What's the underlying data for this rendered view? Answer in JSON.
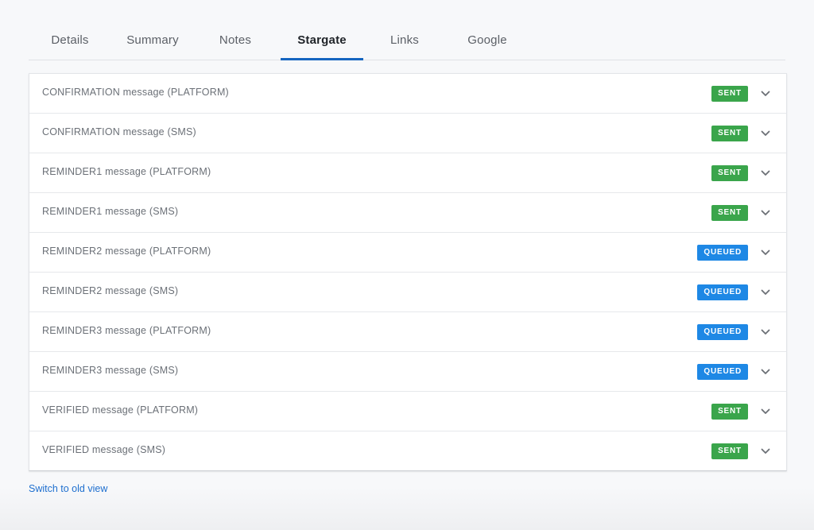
{
  "tabs": [
    {
      "label": "Details",
      "active": false
    },
    {
      "label": "Summary",
      "active": false
    },
    {
      "label": "Notes",
      "active": false
    },
    {
      "label": "Stargate",
      "active": true
    },
    {
      "label": "Links",
      "active": false
    },
    {
      "label": "Google",
      "active": false
    }
  ],
  "messages": [
    {
      "label": "CONFIRMATION message (PLATFORM)",
      "status": "SENT"
    },
    {
      "label": "CONFIRMATION message (SMS)",
      "status": "SENT"
    },
    {
      "label": "REMINDER1 message (PLATFORM)",
      "status": "SENT"
    },
    {
      "label": "REMINDER1 message (SMS)",
      "status": "SENT"
    },
    {
      "label": "REMINDER2 message (PLATFORM)",
      "status": "QUEUED"
    },
    {
      "label": "REMINDER2 message (SMS)",
      "status": "QUEUED"
    },
    {
      "label": "REMINDER3 message (PLATFORM)",
      "status": "QUEUED"
    },
    {
      "label": "REMINDER3 message (SMS)",
      "status": "QUEUED"
    },
    {
      "label": "VERIFIED message (PLATFORM)",
      "status": "SENT"
    },
    {
      "label": "VERIFIED message (SMS)",
      "status": "SENT"
    }
  ],
  "footer": {
    "switch_link": "Switch to old view"
  },
  "colors": {
    "accent": "#1565c0",
    "sent": "#3aa54b",
    "queued": "#1e88e5",
    "link": "#1e6fcf"
  },
  "icons": {
    "expand": "chevron-down-icon"
  }
}
